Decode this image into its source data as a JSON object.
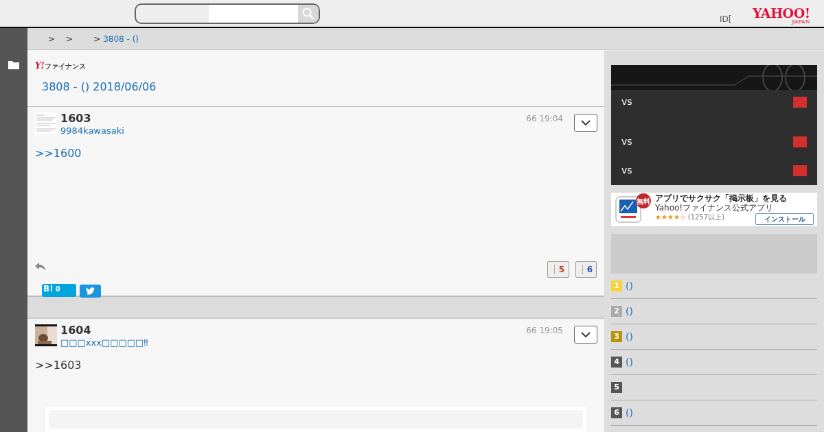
{
  "header": {
    "login_text": "ID[",
    "logo": {
      "main": "YAHOO!",
      "sub": "JAPAN"
    }
  },
  "breadcrumb": [
    {
      "kind": "sep",
      "text": ">"
    },
    {
      "kind": "sep",
      "text": ">"
    },
    {
      "kind": "sep",
      "text": ">"
    },
    {
      "kind": "link",
      "text": "3808 - ()"
    }
  ],
  "page": {
    "brand": {
      "mark": "Y!",
      "name": "ファイナンス"
    },
    "title": "3808 - () 2018/06/06"
  },
  "posts": [
    {
      "kind": "reply",
      "number": "1603",
      "user": "9984kawasaki",
      "time": "66 19:04",
      "body": ">>1600",
      "likes": "5",
      "dislikes": "6",
      "hatena": {
        "label": "B!",
        "count": "0"
      }
    },
    {
      "kind": "plain",
      "number": "1604",
      "user": "□□□xxx□□□□□‼",
      "time": "66 19:05",
      "body": ">>1603"
    }
  ],
  "sidebar": {
    "games": [
      {
        "label": "vs"
      },
      {
        "label": "vs"
      },
      {
        "label": "vs"
      }
    ],
    "ad": {
      "badge": "無料",
      "headline": "アプリでサクサク「掲示板」を見る",
      "app": "Yahoo!ファイナンス公式アプリ",
      "stars": 4,
      "rating_count": "(1257以上)",
      "button": "インストール"
    },
    "ranking": [
      {
        "rank": "1",
        "color": "#f5d33a",
        "text": "()"
      },
      {
        "rank": "2",
        "color": "#aaaaaa",
        "text": "()"
      },
      {
        "rank": "3",
        "color": "#b8930c",
        "text": "()"
      },
      {
        "rank": "4",
        "color": "#555555",
        "text": "()"
      },
      {
        "rank": "5",
        "color": "#555555"
      },
      {
        "rank": "6",
        "color": "#555555",
        "text": "()"
      }
    ]
  }
}
